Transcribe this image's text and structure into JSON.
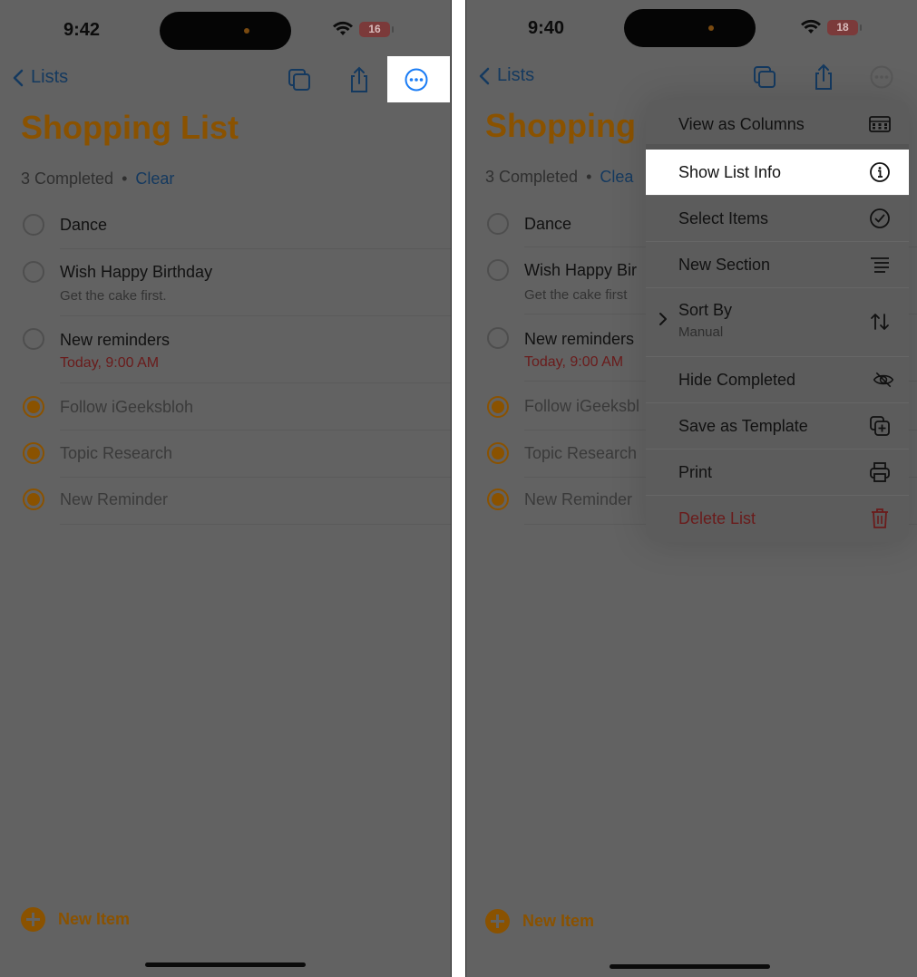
{
  "status": {
    "left_time": "9:42",
    "right_time": "9:40",
    "left_battery": "16",
    "right_battery": "18"
  },
  "nav": {
    "back_label": "Lists"
  },
  "list": {
    "title": "Shopping List",
    "title_cropped": "Shopping",
    "completed_text": "3 Completed",
    "dot": "•",
    "clear_label": "Clear",
    "clear_cropped": "Clea",
    "items": [
      {
        "title": "Dance",
        "title_cropped": "Dance",
        "done": false
      },
      {
        "title": "Wish Happy Birthday",
        "title_cropped": "Wish Happy Bir",
        "note": "Get the cake first.",
        "note_cropped": "Get the cake first",
        "done": false
      },
      {
        "title": "New reminders",
        "title_cropped": "New reminders",
        "date": "Today, 9:00 AM",
        "done": false
      },
      {
        "title": "Follow iGeeksbloh",
        "title_cropped": "Follow iGeeksbl",
        "done": true
      },
      {
        "title": "Topic Research",
        "title_cropped": "Topic Research",
        "done": true
      },
      {
        "title": "New Reminder",
        "title_cropped": "New Reminder",
        "done": true
      }
    ],
    "new_item_label": "New Item"
  },
  "menu": {
    "items": [
      {
        "label": "View as Columns",
        "icon": "columns-icon"
      },
      {
        "label": "Show List Info",
        "icon": "info-circle-icon"
      },
      {
        "label": "Select Items",
        "icon": "checkmark-circle-icon"
      },
      {
        "label": "New Section",
        "icon": "section-lines-icon"
      },
      {
        "label": "Sort By",
        "sub": "Manual",
        "icon": "sort-arrows-icon"
      },
      {
        "label": "Hide Completed",
        "icon": "eye-slash-icon"
      },
      {
        "label": "Save as Template",
        "icon": "duplicate-plus-icon"
      },
      {
        "label": "Print",
        "icon": "printer-icon"
      },
      {
        "label": "Delete List",
        "icon": "trash-icon"
      }
    ]
  },
  "colors": {
    "overlay_gray": "#626262",
    "accent_orange_dim": "#8a5200",
    "link_blue_dim": "#14395f",
    "link_blue_highlight": "#1a7cf5",
    "destructive_red_dim": "#6a1b1b"
  }
}
